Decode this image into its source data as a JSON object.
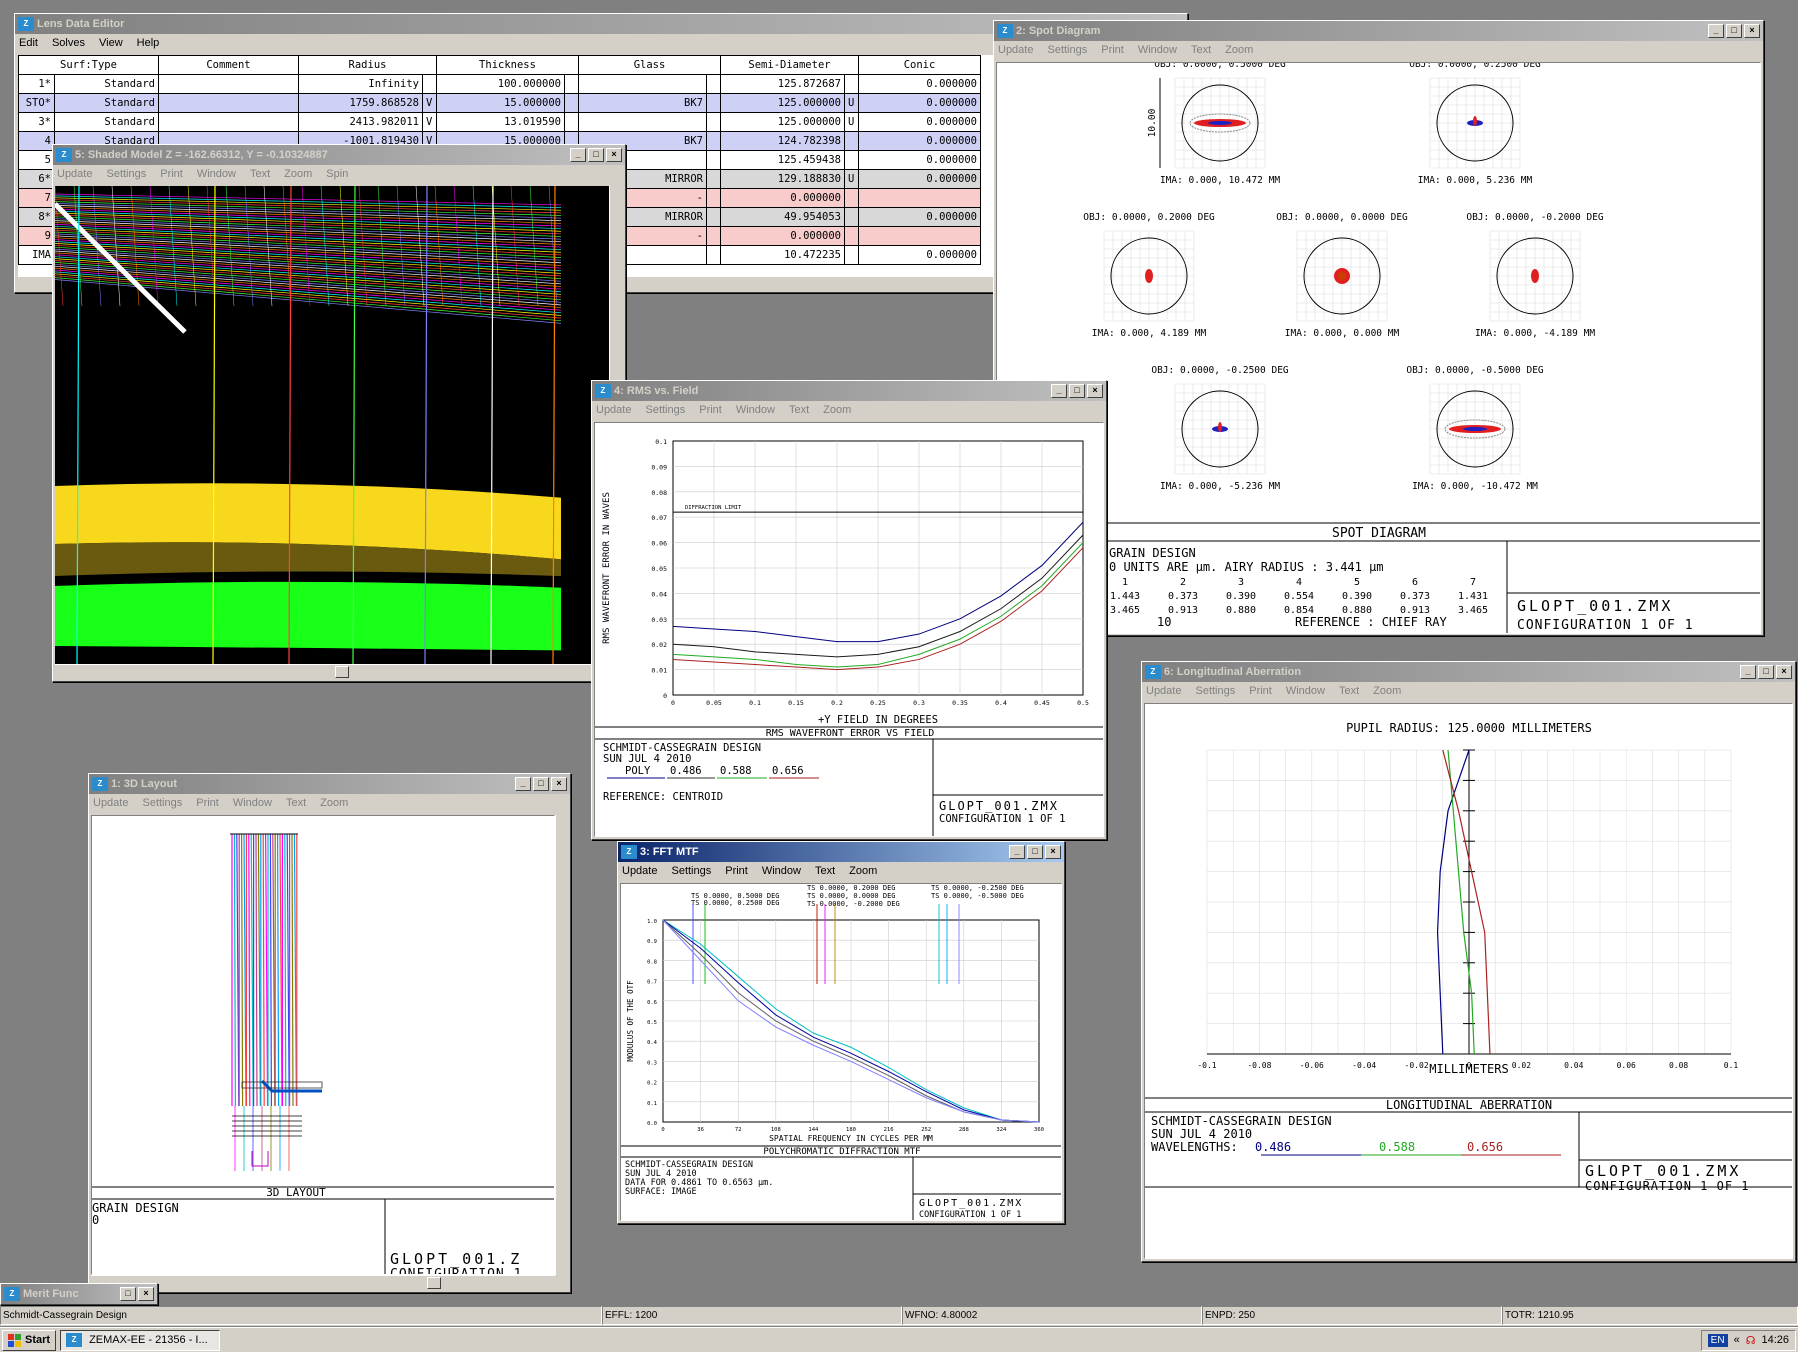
{
  "lde": {
    "title": "Lens Data Editor",
    "menu": [
      "Edit",
      "Solves",
      "View",
      "Help"
    ],
    "columns": [
      "Surf:Type",
      "Comment",
      "Radius",
      "Thickness",
      "Glass",
      "Semi-Diameter",
      "Conic"
    ],
    "rows": [
      {
        "surf": "1*",
        "type": "Standard",
        "comment": "",
        "radius": "Infinity",
        "rf": "",
        "thick": "100.000000",
        "tf": "",
        "glass": "",
        "semi": "125.872687",
        "sf": "",
        "conic": "0.000000",
        "style": ""
      },
      {
        "surf": "STO*",
        "type": "Standard",
        "comment": "",
        "radius": "1759.868528",
        "rf": "V",
        "thick": "15.000000",
        "tf": "",
        "glass": "BK7",
        "semi": "125.000000",
        "sf": "U",
        "conic": "0.000000",
        "style": "blue"
      },
      {
        "surf": "3*",
        "type": "Standard",
        "comment": "",
        "radius": "2413.982011",
        "rf": "V",
        "thick": "13.019590",
        "tf": "",
        "glass": "",
        "semi": "125.000000",
        "sf": "U",
        "conic": "0.000000",
        "style": ""
      },
      {
        "surf": "4",
        "type": "Standard",
        "comment": "",
        "radius": "-1001.819430",
        "rf": "V",
        "thick": "15.000000",
        "tf": "",
        "glass": "BK7",
        "semi": "124.782398",
        "sf": "",
        "conic": "0.000000",
        "style": "blue"
      },
      {
        "surf": "5",
        "type": "",
        "comment": "",
        "radius": "",
        "rf": "",
        "thick": "",
        "tf": "",
        "glass": "",
        "semi": "125.459438",
        "sf": "",
        "conic": "0.000000",
        "style": ""
      },
      {
        "surf": "6*",
        "type": "",
        "comment": "",
        "radius": "",
        "rf": "",
        "thick": "",
        "tf": "",
        "glass": "MIRROR",
        "semi": "129.188830",
        "sf": "U",
        "conic": "0.000000",
        "style": "grey"
      },
      {
        "surf": "7",
        "type": "",
        "comment": "",
        "radius": "",
        "rf": "",
        "thick": "",
        "tf": "",
        "glass": "-",
        "semi": "0.000000",
        "sf": "",
        "conic": "",
        "style": "pink"
      },
      {
        "surf": "8*",
        "type": "",
        "comment": "",
        "radius": "",
        "rf": "",
        "thick": "",
        "tf": "",
        "glass": "MIRROR",
        "semi": "49.954053",
        "sf": "",
        "conic": "0.000000",
        "style": "grey"
      },
      {
        "surf": "9",
        "type": "",
        "comment": "",
        "radius": "",
        "rf": "",
        "thick": "",
        "tf": "",
        "glass": "-",
        "semi": "0.000000",
        "sf": "",
        "conic": "",
        "style": "pink"
      },
      {
        "surf": "IMA",
        "type": "",
        "comment": "",
        "radius": "",
        "rf": "",
        "thick": "",
        "tf": "",
        "glass": "",
        "semi": "10.472235",
        "sf": "",
        "conic": "0.000000",
        "style": ""
      }
    ]
  },
  "shaded": {
    "title": "5: Shaded Model Z = -162.66312, Y = -0.10324887",
    "menu": [
      "Update",
      "Settings",
      "Print",
      "Window",
      "Text",
      "Zoom",
      "Spin"
    ]
  },
  "spot": {
    "title": "2: Spot Diagram",
    "menu": [
      "Update",
      "Settings",
      "Print",
      "Window",
      "Text",
      "Zoom"
    ],
    "obj": [
      "OBJ: 0.0000, 0.5000 DEG",
      "OBJ: 0.0000, 0.2500 DEG",
      "OBJ: 0.0000, 0.2000 DEG",
      "OBJ: 0.0000, 0.0000 DEG",
      "OBJ: 0.0000, -0.2000 DEG",
      "OBJ: 0.0000, -0.2500 DEG",
      "OBJ: 0.0000, -0.5000 DEG"
    ],
    "ima": [
      "IMA: 0.000, 10.472 MM",
      "IMA: 0.000, 5.236 MM",
      "IMA: 0.000, 4.189 MM",
      "IMA: 0.000, 0.000 MM",
      "IMA: 0.000, -4.189 MM",
      "IMA: 0.000, -5.236 MM",
      "IMA: 0.000, -10.472 MM"
    ],
    "scale": "10.00",
    "footer_title": "SPOT DIAGRAM",
    "info1": "GRAIN DESIGN",
    "info2": "0  UNITS ARE µm.  AIRY RADIUS : 3.441 µm",
    "field_nums": [
      "1",
      "2",
      "3",
      "4",
      "5",
      "6",
      "7"
    ],
    "rms": [
      "1.443",
      "0.373",
      "0.390",
      "0.554",
      "0.390",
      "0.373",
      "1.431"
    ],
    "geo": [
      "3.465",
      "0.913",
      "0.880",
      "0.854",
      "0.880",
      "0.913",
      "3.465"
    ],
    "ref_prefix": "10",
    "ref": "REFERENCE  : CHIEF RAY",
    "file": "GLOPT_001.ZMX",
    "config": "CONFIGURATION 1 OF 1"
  },
  "rms": {
    "title": "4: RMS vs. Field",
    "menu": [
      "Update",
      "Settings",
      "Print",
      "Window",
      "Text",
      "Zoom"
    ],
    "xlabel": "+Y FIELD IN DEGREES",
    "ylabel": "RMS WAVEFRONT ERROR IN WAVES",
    "diff_label": "DIFFRACTION LIMIT",
    "footer_title": "RMS WAVEFRONT ERROR VS FIELD",
    "info1": "SCHMIDT-CASSEGRAIN DESIGN",
    "info2": "SUN JUL 4 2010",
    "poly": "POLY",
    "w1": "0.486",
    "w2": "0.588",
    "w3": "0.656",
    "ref": "REFERENCE: CENTROID",
    "file": "GLOPT_001.ZMX",
    "config": "CONFIGURATION 1 OF 1",
    "yticks": [
      "0.1",
      "0.09",
      "0.08",
      "0.07",
      "0.06",
      "0.05",
      "0.04",
      "0.03",
      "0.02",
      "0.01",
      "0"
    ],
    "xticks": [
      "0",
      "0.05",
      "0.1",
      "0.15",
      "0.2",
      "0.25",
      "0.3",
      "0.35",
      "0.4",
      "0.45",
      "0.5"
    ]
  },
  "chart_data": [
    {
      "type": "line",
      "title": "RMS WAVEFRONT ERROR VS FIELD",
      "xlabel": "+Y FIELD IN DEGREES",
      "ylabel": "RMS WAVEFRONT ERROR IN WAVES",
      "xlim": [
        0,
        0.5
      ],
      "ylim": [
        0,
        0.1
      ],
      "x": [
        0,
        0.05,
        0.1,
        0.15,
        0.2,
        0.25,
        0.3,
        0.35,
        0.4,
        0.45,
        0.5
      ],
      "series": [
        {
          "name": "POLY",
          "color": "#000080",
          "values": [
            0.027,
            0.026,
            0.025,
            0.023,
            0.021,
            0.021,
            0.024,
            0.03,
            0.039,
            0.051,
            0.068
          ]
        },
        {
          "name": "0.486",
          "color": "#1a1a1a",
          "values": [
            0.02,
            0.019,
            0.017,
            0.016,
            0.015,
            0.016,
            0.019,
            0.025,
            0.034,
            0.046,
            0.063
          ]
        },
        {
          "name": "0.588",
          "color": "#22aa22",
          "values": [
            0.016,
            0.015,
            0.014,
            0.012,
            0.011,
            0.012,
            0.016,
            0.022,
            0.031,
            0.043,
            0.06
          ]
        },
        {
          "name": "0.656",
          "color": "#aa2222",
          "values": [
            0.014,
            0.013,
            0.012,
            0.011,
            0.01,
            0.011,
            0.014,
            0.02,
            0.029,
            0.041,
            0.058
          ]
        }
      ],
      "hline": {
        "label": "DIFFRACTION LIMIT",
        "value": 0.072
      }
    },
    {
      "type": "line",
      "title": "POLYCHROMATIC DIFFRACTION MTF",
      "xlabel": "SPATIAL FREQUENCY IN CYCLES PER MM",
      "ylabel": "MODULUS OF THE OTF",
      "xlim": [
        0,
        360
      ],
      "ylim": [
        0,
        1
      ],
      "x": [
        0,
        36,
        72,
        108,
        144,
        180,
        216,
        252,
        288,
        324,
        360
      ],
      "series": [
        {
          "color": "#00c0c0",
          "values": [
            1,
            0.88,
            0.72,
            0.56,
            0.44,
            0.37,
            0.27,
            0.16,
            0.07,
            0.01,
            0
          ]
        },
        {
          "color": "#0000a0",
          "values": [
            1,
            0.86,
            0.69,
            0.53,
            0.42,
            0.34,
            0.25,
            0.15,
            0.06,
            0.01,
            0
          ]
        },
        {
          "color": "#606060",
          "values": [
            1,
            0.83,
            0.64,
            0.5,
            0.4,
            0.32,
            0.23,
            0.13,
            0.05,
            0.01,
            0
          ]
        },
        {
          "color": "#8080ff",
          "values": [
            1,
            0.8,
            0.6,
            0.47,
            0.38,
            0.3,
            0.21,
            0.12,
            0.05,
            0.01,
            0
          ]
        }
      ]
    },
    {
      "type": "line",
      "title": "LONGITUDINAL ABERRATION",
      "xlabel": "MILLIMETERS",
      "xlim": [
        -0.1,
        0.1
      ],
      "ylim": [
        0,
        1
      ],
      "series": [
        {
          "name": "0.486",
          "color": "#000080",
          "points": [
            [
              -0.01,
              0
            ],
            [
              -0.011,
              0.2
            ],
            [
              -0.012,
              0.4
            ],
            [
              -0.011,
              0.6
            ],
            [
              -0.008,
              0.8
            ],
            [
              0,
              1
            ]
          ]
        },
        {
          "name": "0.588",
          "color": "#22aa22",
          "points": [
            [
              0.002,
              0
            ],
            [
              0.001,
              0.2
            ],
            [
              -0.002,
              0.4
            ],
            [
              -0.004,
              0.6
            ],
            [
              -0.006,
              0.8
            ],
            [
              -0.008,
              1
            ]
          ]
        },
        {
          "name": "0.656",
          "color": "#aa2222",
          "points": [
            [
              0.008,
              0
            ],
            [
              0.007,
              0.2
            ],
            [
              0.006,
              0.4
            ],
            [
              0.001,
              0.6
            ],
            [
              -0.004,
              0.8
            ],
            [
              -0.01,
              1
            ]
          ]
        }
      ]
    }
  ],
  "mtf": {
    "title": "3: FFT MTF",
    "menu": [
      "Update",
      "Settings",
      "Print",
      "Window",
      "Text",
      "Zoom"
    ],
    "legend": [
      "TS 0.0000, 0.5000 DEG",
      "TS 0.0000, 0.2500 DEG",
      "TS 0.0000, 0.2000 DEG",
      "TS 0.0000, 0.0000 DEG",
      "TS 0.0000, -0.2000 DEG",
      "TS 0.0000, -0.2500 DEG",
      "TS 0.0000, -0.5000 DEG"
    ],
    "xlabel": "SPATIAL FREQUENCY IN CYCLES PER MM",
    "ylabel": "MODULUS OF THE OTF",
    "footer_title": "POLYCHROMATIC DIFFRACTION MTF",
    "info1": "SCHMIDT-CASSEGRAIN DESIGN",
    "info2": "SUN JUL 4 2010",
    "info3": "DATA FOR 0.4861 TO 0.6563 µm.",
    "info4": "SURFACE: IMAGE",
    "file": "GLOPT_001.ZMX",
    "config": "CONFIGURATION 1 OF 1",
    "xticks": [
      "0",
      "36",
      "72",
      "108",
      "144",
      "180",
      "216",
      "252",
      "288",
      "324",
      "360"
    ],
    "yticks": [
      "1.0",
      "0.9",
      "0.8",
      "0.7",
      "0.6",
      "0.5",
      "0.4",
      "0.3",
      "0.2",
      "0.1",
      "0.0"
    ]
  },
  "layout3d": {
    "title": "1: 3D Layout",
    "menu": [
      "Update",
      "Settings",
      "Print",
      "Window",
      "Text",
      "Zoom"
    ],
    "footer_title": "3D LAYOUT",
    "info1": "GRAIN DESIGN",
    "info2": "0",
    "file": "GLOPT_001.Z",
    "config": "CONFIGURATION 1"
  },
  "longab": {
    "title": "6: Longitudinal Aberration",
    "menu": [
      "Update",
      "Settings",
      "Print",
      "Window",
      "Text",
      "Zoom"
    ],
    "pupil": "PUPIL RADIUS: 125.0000 MILLIMETERS",
    "xlabel": "MILLIMETERS",
    "footer_title": "LONGITUDINAL ABERRATION",
    "info1": "SCHMIDT-CASSEGRAIN DESIGN",
    "info2": "SUN JUL 4 2010",
    "wl_label": "WAVELENGTHS:",
    "w1": "0.486",
    "w2": "0.588",
    "w3": "0.656",
    "file": "GLOPT_001.ZMX",
    "config": "CONFIGURATION 1 OF 1",
    "xticks": [
      "-0.1",
      "-0.08",
      "-0.06",
      "-0.04",
      "-0.02",
      "0",
      "0.02",
      "0.04",
      "0.06",
      "0.08",
      "0.1"
    ]
  },
  "merit": {
    "title": "Merit Func"
  },
  "status": {
    "design": "Schmidt-Cassegrain Design",
    "effl": "EFFL: 1200",
    "wfno": "WFNO: 4.80002",
    "enpd": "ENPD: 250",
    "totr": "TOTR: 1210.95"
  },
  "taskbar": {
    "start": "Start",
    "app": "ZEMAX-EE - 21356 - I...",
    "lang": "EN",
    "time": "14:26"
  }
}
